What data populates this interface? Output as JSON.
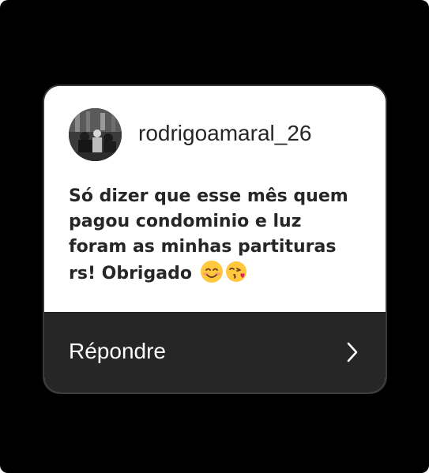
{
  "story_reply": {
    "username": "rodrigoamaral_26",
    "message_lines": [
      "Só dizer que esse mês quem",
      "pagou condominio e luz",
      "foram as minhas partituras",
      "rs! Obrigado"
    ],
    "emojis": [
      "smiling-face-emoji",
      "face-blowing-kiss-emoji"
    ],
    "reply_label": "Répondre",
    "chevron_icon": "chevron-right-icon"
  },
  "colors": {
    "background": "#000000",
    "card_top": "#ffffff",
    "card_bottom": "#262626",
    "text_dark": "#262626",
    "text_light": "#ffffff"
  }
}
